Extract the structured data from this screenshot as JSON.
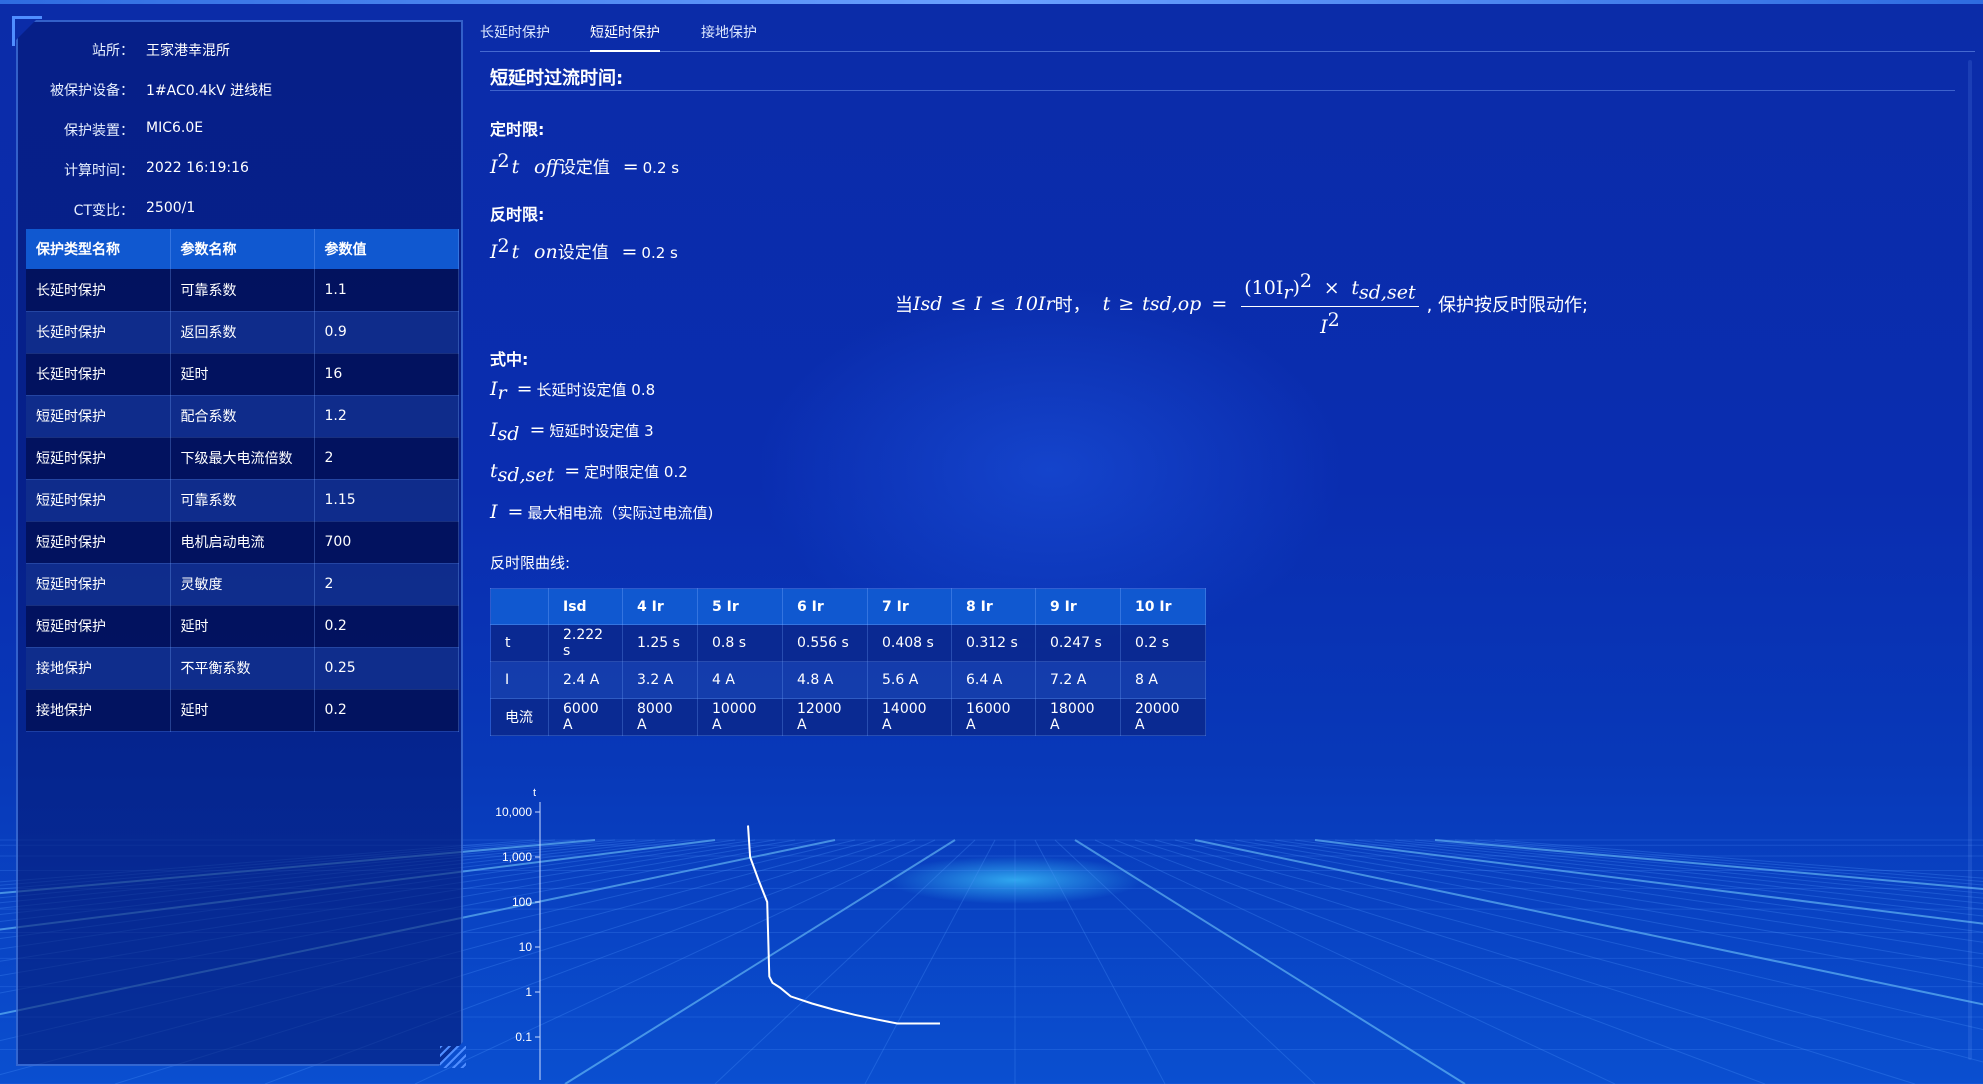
{
  "station": {
    "rows": [
      {
        "label": "站所：",
        "value": "王家港幸混所"
      },
      {
        "label": "被保护设备：",
        "value": "1#AC0.4kV 进线柜"
      },
      {
        "label": "保护装置：",
        "value": "MIC6.0E"
      },
      {
        "label": "计算时间：",
        "value": "2022 16:19:16"
      },
      {
        "label": "CT变比：",
        "value": "2500/1"
      }
    ]
  },
  "params": {
    "headers": [
      "保护类型名称",
      "参数名称",
      "参数值"
    ],
    "rows": [
      [
        "长延时保护",
        "可靠系数",
        "1.1"
      ],
      [
        "长延时保护",
        "返回系数",
        "0.9"
      ],
      [
        "长延时保护",
        "延时",
        "16"
      ],
      [
        "短延时保护",
        "配合系数",
        "1.2"
      ],
      [
        "短延时保护",
        "下级最大电流倍数",
        "2"
      ],
      [
        "短延时保护",
        "可靠系数",
        "1.15"
      ],
      [
        "短延时保护",
        "电机启动电流",
        "700"
      ],
      [
        "短延时保护",
        "灵敏度",
        "2"
      ],
      [
        "短延时保护",
        "延时",
        "0.2"
      ],
      [
        "接地保护",
        "不平衡系数",
        "0.25"
      ],
      [
        "接地保护",
        "延时",
        "0.2"
      ]
    ]
  },
  "tabs": [
    "长延时保护",
    "短延时保护",
    "接地保护"
  ],
  "content": {
    "title": "短延时过流时间:",
    "definite_heading": "定时限:",
    "definite_line": {
      "prefix": "I",
      "exp": "2",
      "var": "t",
      "mode": "off",
      "label": "设定值",
      "eq": "=",
      "value": "0.2 s"
    },
    "inverse_heading": "反时限:",
    "inverse_line": {
      "prefix": "I",
      "exp": "2",
      "var": "t",
      "mode": "on",
      "label": "设定值",
      "eq": "=",
      "value": "0.2 s"
    },
    "formula": {
      "when": "当",
      "isd": "I",
      "isd_sub": "sd",
      "le": "≤",
      "i": "I",
      "ten_ir": "10I",
      "ir_sub": "r",
      "shi": "时，",
      "t": "t",
      "ge": "≥",
      "tsdop": "t",
      "tsdop_sub": "sd,op",
      "eq": "=",
      "num": "(10I",
      "num_sub": "r",
      "num_close": ")",
      "num_exp": "2",
      "times": "×",
      "tset": "t",
      "tset_sub": "sd,set",
      "den": "I",
      "den_exp": "2",
      "tail": ", 保护按反时限动作;"
    },
    "where_heading": "式中:",
    "where": [
      {
        "sym": "I",
        "sub": "r",
        "text": "长延时设定值 0.8"
      },
      {
        "sym": "I",
        "sub": "sd",
        "text": "短延时设定值 3"
      },
      {
        "sym": "t",
        "sub": "sd,set",
        "text": "定时限定值 0.2"
      },
      {
        "sym": "I",
        "sub": "",
        "text": "最大相电流（实际过电流值)"
      }
    ],
    "eq_sign": "=",
    "curve_heading": "反时限曲线:"
  },
  "curve_table": {
    "headers": [
      "",
      "Isd",
      "4 Ir",
      "5 Ir",
      "6 Ir",
      "7 Ir",
      "8 Ir",
      "9 Ir",
      "10 Ir"
    ],
    "rows": [
      [
        "t",
        "2.222 s",
        "1.25 s",
        "0.8 s",
        "0.556 s",
        "0.408 s",
        "0.312 s",
        "0.247 s",
        "0.2 s"
      ],
      [
        "I",
        "2.4 A",
        "3.2 A",
        "4 A",
        "4.8 A",
        "5.6 A",
        "6.4 A",
        "7.2 A",
        "8 A"
      ],
      [
        "电流",
        "6000 A",
        "8000 A",
        "10000 A",
        "12000 A",
        "14000 A",
        "16000 A",
        "18000 A",
        "20000 A"
      ]
    ]
  },
  "chart_data": {
    "type": "line",
    "ylabel": "t",
    "yscale": "log",
    "ylim": [
      0.1,
      10000
    ],
    "yticks": [
      "10,000",
      "1,000",
      "100",
      "10",
      "1",
      "0.1"
    ],
    "series": [
      {
        "x": [
          6000,
          6200,
          7000,
          7800,
          8000,
          8300,
          9000,
          10000,
          12000,
          14000,
          16000,
          18000,
          20000,
          24000
        ],
        "y": [
          5000,
          1000,
          300,
          100,
          2.222,
          1.6,
          1.25,
          0.8,
          0.556,
          0.408,
          0.312,
          0.247,
          0.2,
          0.2
        ]
      }
    ]
  },
  "colors": {
    "bg": "#0a2db0",
    "header": "#1058d0",
    "accent": "#4f8dff"
  }
}
